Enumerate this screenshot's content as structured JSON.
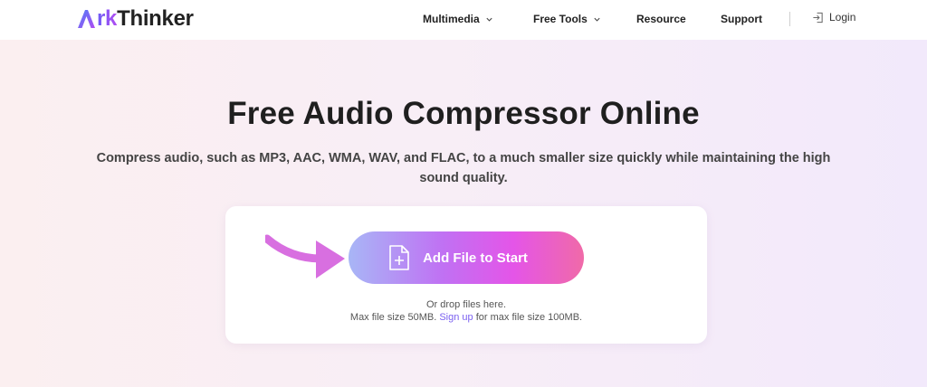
{
  "brand": {
    "name_prefix": "A",
    "name_accent": "rk",
    "name_rest": "Thinker"
  },
  "nav": {
    "items": [
      {
        "label": "Multimedia",
        "has_dropdown": true
      },
      {
        "label": "Free Tools",
        "has_dropdown": true
      },
      {
        "label": "Resource",
        "has_dropdown": false
      },
      {
        "label": "Support",
        "has_dropdown": false
      }
    ],
    "login_label": "Login"
  },
  "hero": {
    "title": "Free Audio Compressor Online",
    "subtitle": "Compress audio, such as MP3, AAC, WMA, WAV, and FLAC, to a much smaller size quickly while maintaining the high sound quality."
  },
  "upload": {
    "button_label": "Add File to Start",
    "drop_text": "Or drop files here.",
    "limit_prefix": "Max file size 50MB.",
    "signup_label": "Sign up",
    "limit_suffix": "for max file size 100MB."
  },
  "colors": {
    "accent_purple": "#7b61f0",
    "button_start": "#a8b6f6",
    "button_mid": "#e455e8",
    "button_end": "#f06aa8",
    "arrow": "#d86fe0"
  },
  "icons": {
    "logo": "arkthinker-logo-icon",
    "chevron": "chevron-down-icon",
    "login": "login-icon",
    "file": "add-file-icon",
    "arrow": "pointing-arrow-icon"
  }
}
